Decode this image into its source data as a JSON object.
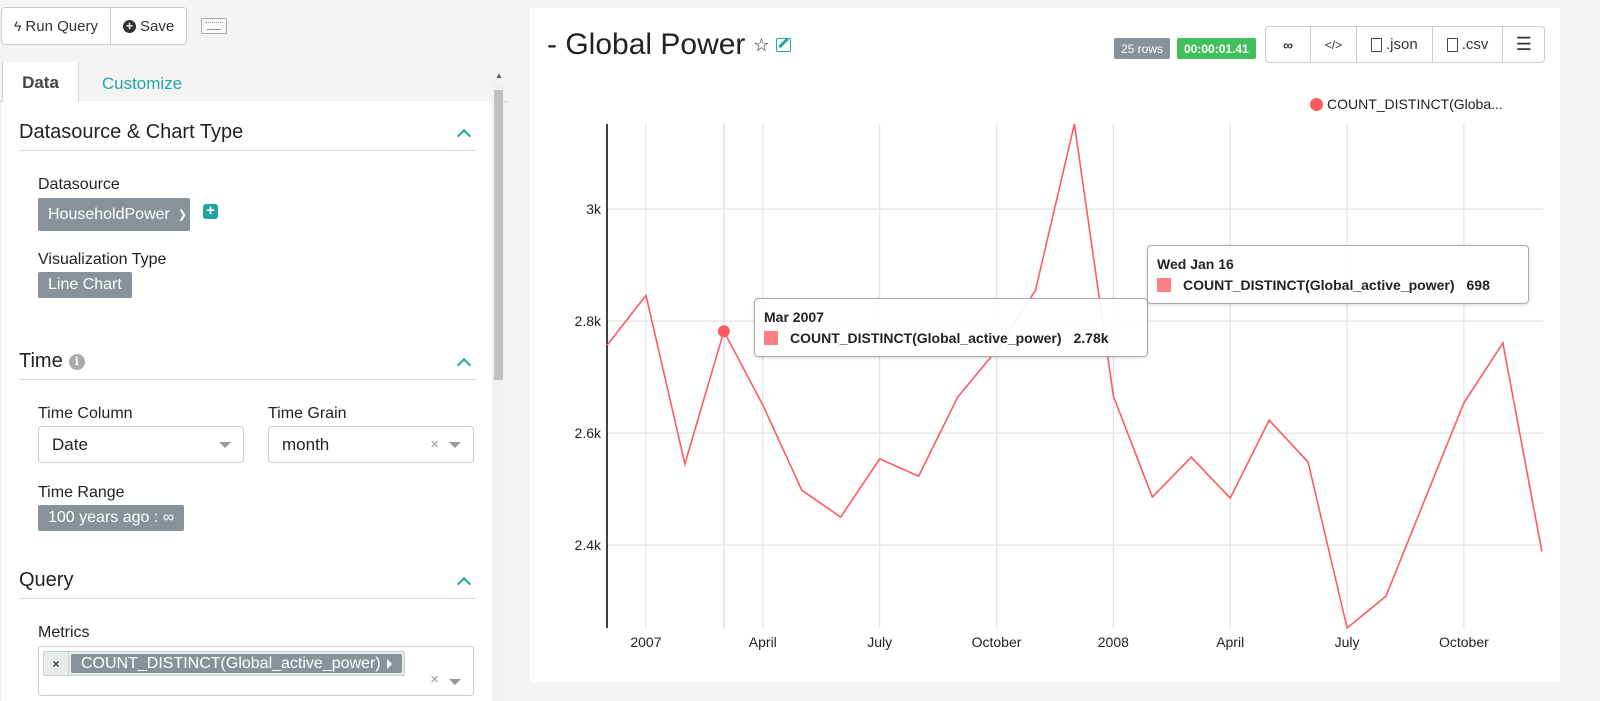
{
  "toolbar": {
    "run_query_label": "Run Query",
    "save_label": "Save",
    "run_icon": "bolt-icon",
    "save_icon": "plus-circle-icon",
    "keyboard_icon": "keyboard-icon"
  },
  "tabs": [
    {
      "label": "Data",
      "active": true
    },
    {
      "label": "Customize",
      "active": false
    }
  ],
  "sections": {
    "datasource": {
      "title": "Datasource & Chart Type",
      "datasource_label": "Datasource",
      "datasource_value": "HouseholdPower",
      "viz_label": "Visualization Type",
      "viz_value": "Line Chart"
    },
    "time": {
      "title": "Time",
      "time_column_label": "Time Column",
      "time_column_value": "Date",
      "time_grain_label": "Time Grain",
      "time_grain_value": "month",
      "time_range_label": "Time Range",
      "time_range_value": "100 years ago : ∞"
    },
    "query": {
      "title": "Query",
      "metrics_label": "Metrics",
      "metrics": [
        "COUNT_DISTINCT(Global_active_power)"
      ]
    }
  },
  "header": {
    "title": "- Global Power",
    "rows_badge": "25 rows",
    "time_badge": "00:00:01.41",
    "actions": [
      {
        "label": "",
        "icon": "link-icon"
      },
      {
        "label": "",
        "icon": "code-icon"
      },
      {
        "label": ".json",
        "icon": "file-code-icon"
      },
      {
        "label": ".csv",
        "icon": "file-text-icon"
      },
      {
        "label": "",
        "icon": "menu-icon"
      }
    ]
  },
  "colors": {
    "accent": "#20a7a0",
    "series": "#ff5a5f",
    "badge_gray": "#879399",
    "badge_green": "#3fc05a"
  },
  "tooltips": [
    {
      "title": "Mar 2007",
      "series": "COUNT_DISTINCT(Global_active_power)",
      "value": "2.78k"
    },
    {
      "title": "Wed Jan 16",
      "series": "COUNT_DISTINCT(Global_active_power)",
      "value": "698"
    }
  ],
  "chart_data": {
    "type": "line",
    "title": "- Global Power",
    "xlabel": "",
    "ylabel": "",
    "legend": {
      "entries": [
        "COUNT_DISTINCT(Globa..."
      ],
      "position": "top-right"
    },
    "grid": true,
    "x": [
      "2006-12",
      "2007-01",
      "2007-02",
      "2007-03",
      "2007-04",
      "2007-05",
      "2007-06",
      "2007-07",
      "2007-08",
      "2007-09",
      "2007-10",
      "2007-11",
      "2007-12",
      "2008-01",
      "2008-02",
      "2008-03",
      "2008-04",
      "2008-05",
      "2008-06",
      "2008-07",
      "2008-08",
      "2008-09",
      "2008-10",
      "2008-11",
      "2008-12"
    ],
    "series": [
      {
        "name": "COUNT_DISTINCT(Global_active_power)",
        "values": [
          2757,
          2846,
          2545,
          2782,
          2650,
          2498,
          2450,
          2554,
          2523,
          2664,
          2748,
          2855,
          3152,
          2666,
          2486,
          2557,
          2484,
          2623,
          2548,
          2252,
          2309,
          2482,
          2654,
          2761,
          2389
        ]
      }
    ],
    "x_ticks": [
      {
        "label": "2007",
        "index": 1
      },
      {
        "label": "April",
        "index": 4
      },
      {
        "label": "July",
        "index": 7
      },
      {
        "label": "October",
        "index": 10
      },
      {
        "label": "2008",
        "index": 13
      },
      {
        "label": "April",
        "index": 16
      },
      {
        "label": "July",
        "index": 19
      },
      {
        "label": "October",
        "index": 22
      }
    ],
    "y_ticks": [
      {
        "label": "2.4k",
        "value": 2400
      },
      {
        "label": "2.6k",
        "value": 2600
      },
      {
        "label": "2.8k",
        "value": 2800
      },
      {
        "label": "3k",
        "value": 3000
      }
    ],
    "ylim": [
      2252,
      3152
    ],
    "highlighted_index": 3,
    "extra_vertical_grid_index": 3
  }
}
